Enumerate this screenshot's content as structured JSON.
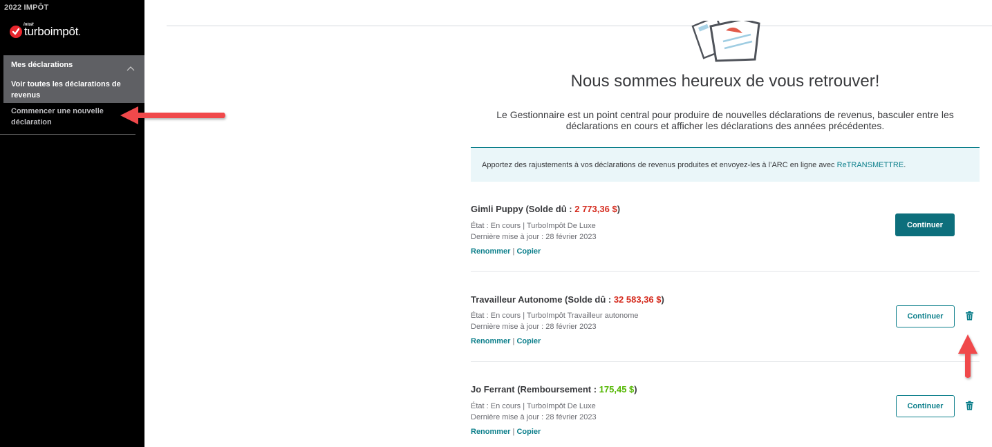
{
  "sidebar": {
    "year": "2022 IMPÔT",
    "logo": {
      "intuit": "intuit",
      "brand": "turboimpôt",
      "dot": "."
    },
    "section_title": "Mes déclarations",
    "items": [
      {
        "label": "Voir toutes les déclarations de revenus",
        "active": true
      },
      {
        "label": "Commencer une nouvelle déclaration",
        "active": false
      }
    ]
  },
  "main": {
    "welcome": "Nous sommes heureux de vous retrouver!",
    "intro": "Le Gestionnaire est un point central pour produire de nouvelles déclarations de revenus, basculer entre les déclarations en cours et afficher les déclarations des années précédentes.",
    "banner": {
      "text": "Apportez des rajustements à vos déclarations de revenus produites et envoyez-les à l’ARC en ligne avec ",
      "link": "ReTRANSMETTRE",
      "end": "."
    },
    "returns": [
      {
        "name": "Gimli Puppy",
        "balance_prefix": " (Solde dû : ",
        "amount": "2 773,36 $",
        "balance_suffix": ")",
        "amount_type": "due",
        "status": "État : En cours | TurboImpôt De Luxe",
        "updated": "Dernière mise à jour : 28 février 2023",
        "rename": "Renommer",
        "separator": "|",
        "copy": "Copier",
        "button": "Continuer"
      },
      {
        "name": "Travailleur Autonome",
        "balance_prefix": " (Solde dû : ",
        "amount": "32 583,36 $",
        "balance_suffix": ")",
        "amount_type": "due",
        "status": "État : En cours | TurboImpôt Travailleur autonome",
        "updated": "Dernière mise à jour : 28 février 2023",
        "rename": "Renommer",
        "separator": "|",
        "copy": "Copier",
        "button": "Continuer"
      },
      {
        "name": "Jo Ferrant",
        "balance_prefix": " (Remboursement : ",
        "amount": "175,45 $",
        "balance_suffix": ")",
        "amount_type": "refund",
        "status": "État : En cours | TurboImpôt De Luxe",
        "updated": "Dernière mise à jour : 28 février 2023",
        "rename": "Renommer",
        "separator": "|",
        "copy": "Copier",
        "button": "Continuer"
      }
    ]
  },
  "colors": {
    "accent": "#0c7f8b",
    "primary_button": "#0d6f7c",
    "due": "#d52b1e",
    "refund": "#53b700",
    "annotation_arrow": "#f0494c"
  },
  "icons": [
    "check-logo-icon",
    "chevron-up-icon",
    "documents-illustration",
    "trash-icon",
    "arrow-left-annotation",
    "arrow-up-annotation"
  ]
}
